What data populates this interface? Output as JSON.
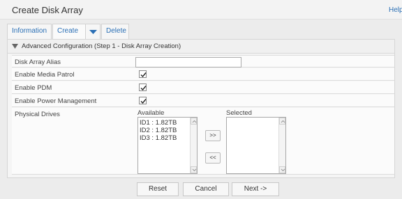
{
  "header": {
    "title": "Create Disk Array",
    "help_label": "Help"
  },
  "tabs": [
    {
      "label": "Information"
    },
    {
      "label": "Create"
    },
    {
      "label": "Delete"
    }
  ],
  "section": {
    "title": "Advanced Configuration (Step 1 - Disk Array Creation)"
  },
  "form": {
    "alias": {
      "label": "Disk Array Alias",
      "value": "",
      "placeholder": ""
    },
    "media_patrol": {
      "label": "Enable Media Patrol",
      "checked": true
    },
    "pdm": {
      "label": "Enable PDM",
      "checked": true
    },
    "power_mgmt": {
      "label": "Enable Power Management",
      "checked": true
    },
    "physical_drives": {
      "label": "Physical Drives",
      "available_header": "Available",
      "selected_header": "Selected",
      "available": [
        "ID1 : 1.82TB",
        "ID2 : 1.82TB",
        "ID3 : 1.82TB"
      ],
      "selected": [],
      "add_label": ">>",
      "remove_label": "<<"
    }
  },
  "footer": {
    "reset_label": "Reset",
    "cancel_label": "Cancel",
    "next_label": "Next ->"
  },
  "icons": {
    "section_toggle": "triangle-down-icon",
    "tab_menu": "chevron-down-icon",
    "checkbox_mark": "checkmark-icon"
  },
  "colors": {
    "link": "#2a6fb5",
    "caret": "#2a6fb5"
  }
}
